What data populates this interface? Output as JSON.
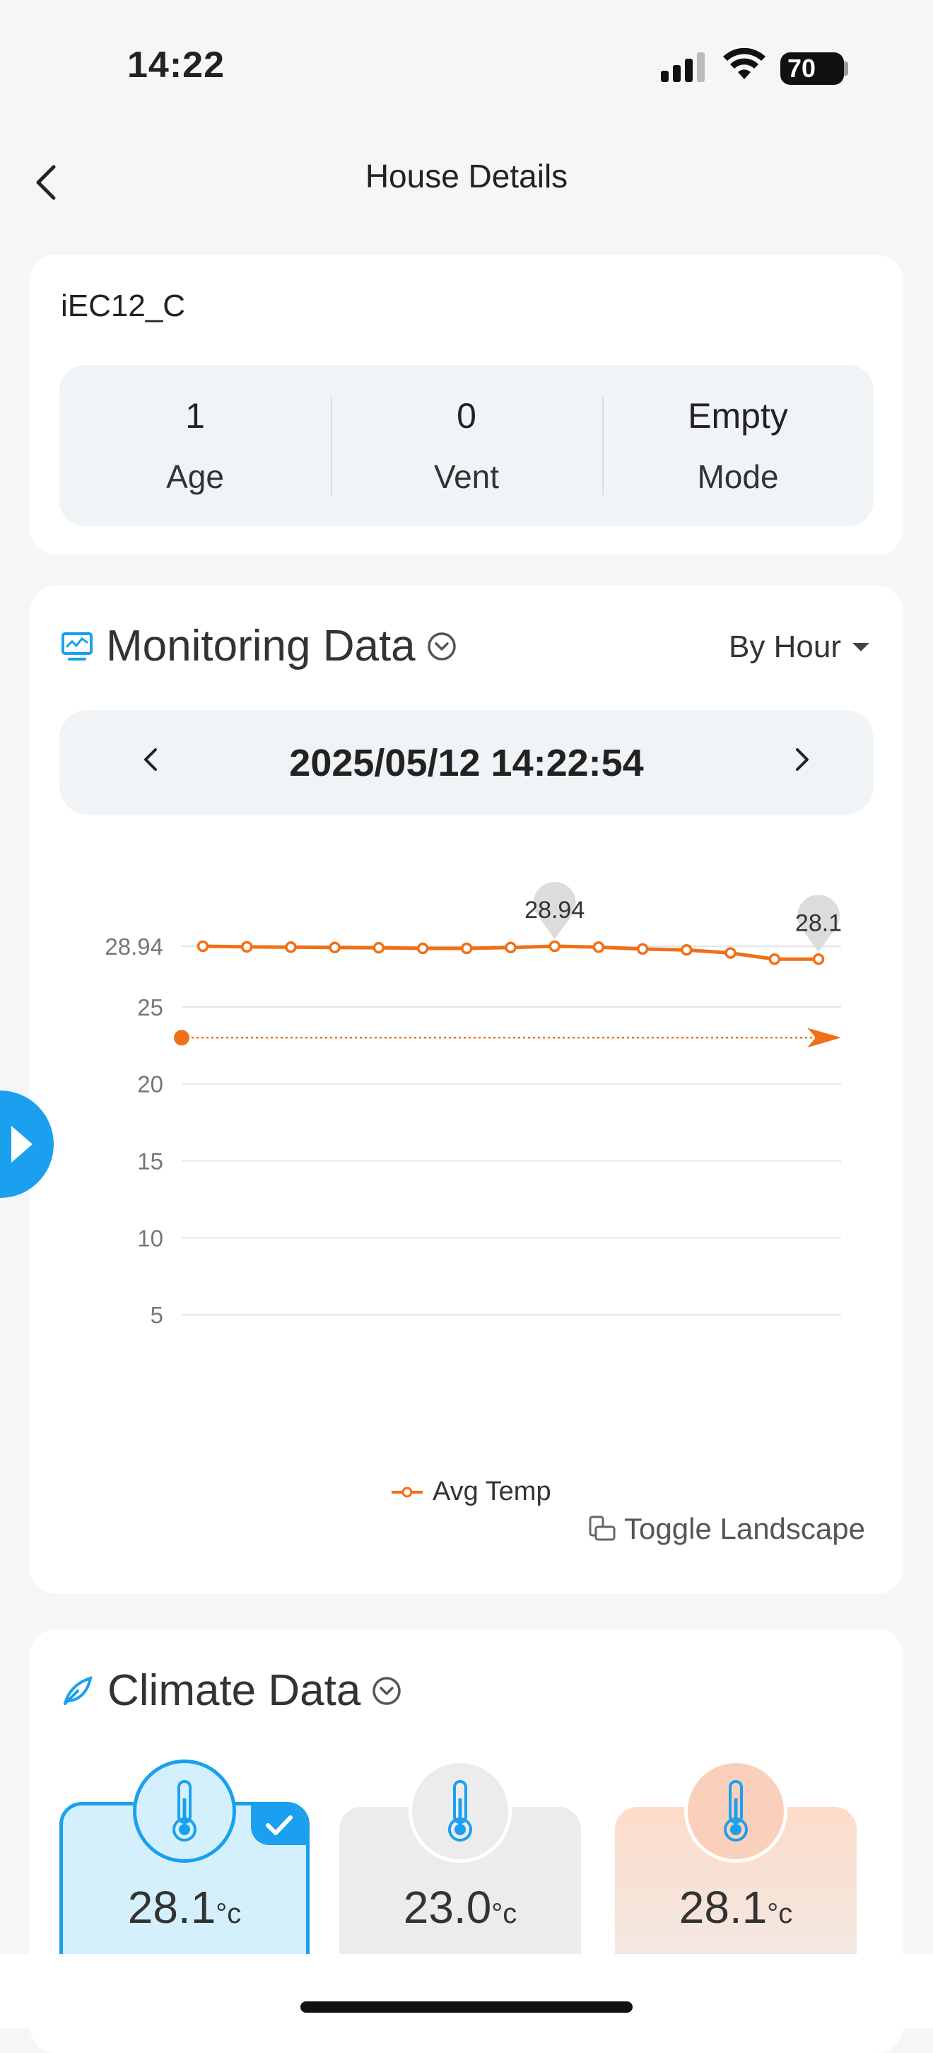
{
  "status_bar": {
    "time": "14:22",
    "battery": "70"
  },
  "nav": {
    "title": "House Details"
  },
  "house": {
    "name": "iEC12_C",
    "stats": [
      {
        "value": "1",
        "label": "Age"
      },
      {
        "value": "0",
        "label": "Vent"
      },
      {
        "value": "Empty",
        "label": "Mode"
      }
    ]
  },
  "monitoring": {
    "title": "Monitoring Data",
    "period": "By Hour",
    "datetime": "2025/05/12 14:22:54",
    "toggle_label": "Toggle Landscape"
  },
  "chart_data": {
    "type": "line",
    "x": [
      0,
      1,
      2,
      3,
      4,
      5,
      6,
      7,
      8,
      9,
      10,
      11,
      12,
      13,
      14
    ],
    "series": [
      {
        "name": "Avg Temp",
        "color": "#f07018",
        "values": [
          28.94,
          28.9,
          28.88,
          28.86,
          28.84,
          28.8,
          28.8,
          28.86,
          28.94,
          28.88,
          28.76,
          28.7,
          28.5,
          28.1,
          28.1
        ]
      }
    ],
    "ylim": [
      0,
      28.94
    ],
    "yticks": [
      "0",
      "5",
      "10",
      "15",
      "20",
      "25",
      "28.94"
    ],
    "max_label": "28.94",
    "last_label": "28.1",
    "reference_line": {
      "value": 23,
      "color": "#f07018"
    },
    "grid": true,
    "legend": "bottom-center"
  },
  "climate": {
    "title": "Climate Data",
    "tiles": [
      {
        "value": "28.1",
        "unit": "°c",
        "selected": true
      },
      {
        "value": "23.0",
        "unit": "°c",
        "selected": false
      },
      {
        "value": "28.1",
        "unit": "°c",
        "selected": false
      }
    ]
  },
  "colors": {
    "accent": "#1aa0ee",
    "series": "#f07018",
    "card": "#ffffff",
    "background": "#f5f6f8"
  }
}
